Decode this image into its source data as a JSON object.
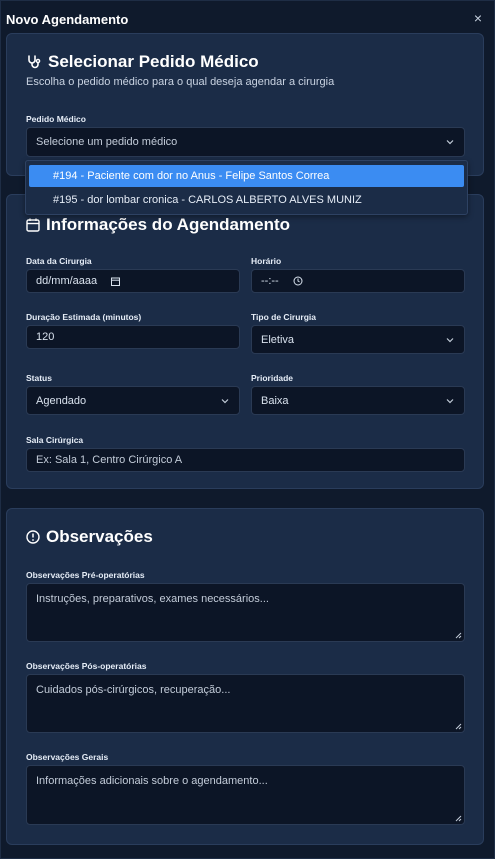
{
  "modal": {
    "title": "Novo Agendamento",
    "close_icon": "×"
  },
  "select_section": {
    "title": "Selecionar Pedido Médico",
    "subtitle": "Escolha o pedido médico para o qual deseja agendar a cirurgia",
    "field_label": "Pedido Médico",
    "placeholder": "Selecione um pedido médico",
    "options": [
      {
        "label": "#194 - Paciente com dor no Anus - Felipe Santos Correa",
        "highlighted": true
      },
      {
        "label": "#195 - dor lombar cronica - CARLOS ALBERTO ALVES MUNIZ",
        "highlighted": false
      }
    ]
  },
  "info_section": {
    "title": "Informações do Agendamento",
    "date_label": "Data da Cirurgia",
    "date_value": "dd/mm/aaaa",
    "time_label": "Horário",
    "time_value": "--:--",
    "duration_label": "Duração Estimada (minutos)",
    "duration_value": "120",
    "type_label": "Tipo de Cirurgia",
    "type_value": "Eletiva",
    "status_label": "Status",
    "status_value": "Agendado",
    "priority_label": "Prioridade",
    "priority_value": "Baixa",
    "room_label": "Sala Cirúrgica",
    "room_placeholder": "Ex: Sala 1, Centro Cirúrgico A"
  },
  "obs_section": {
    "title": "Observações",
    "pre_label": "Observações Pré-operatórias",
    "pre_placeholder": "Instruções, preparativos, exames necessários...",
    "post_label": "Observações Pós-operatórias",
    "post_placeholder": "Cuidados pós-cirúrgicos, recuperação...",
    "general_label": "Observações Gerais",
    "general_placeholder": "Informações adicionais sobre o agendamento..."
  },
  "colors": {
    "background": "#0f1a2c",
    "card": "#1b2c47",
    "input": "#0c1526",
    "highlight": "#3b8cf2"
  }
}
